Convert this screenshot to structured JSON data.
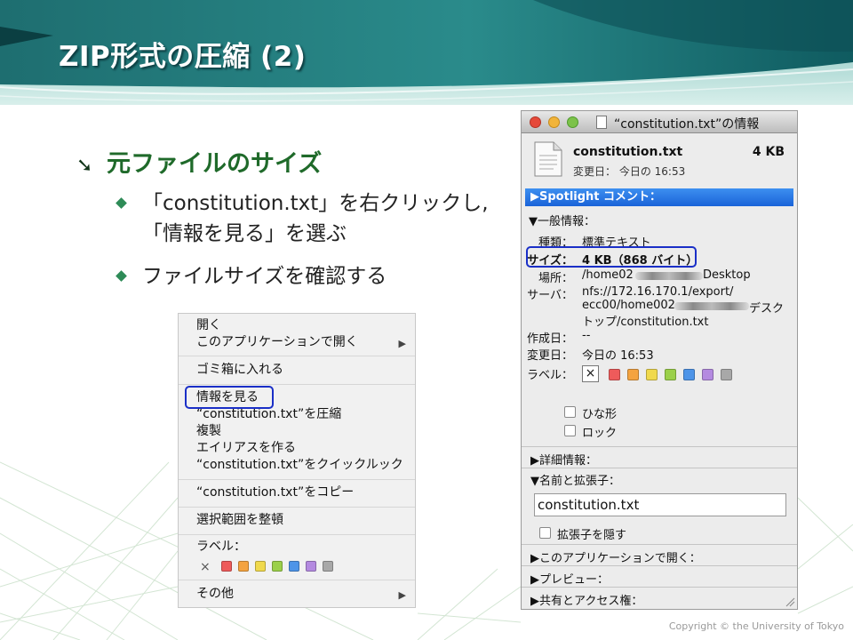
{
  "slide": {
    "title": "ZIP形式の圧縮 (2)",
    "bullet_main": "元ファイルのサイズ",
    "sub_bullets": [
      "「constitution.txt」を右クリックし,",
      "「情報を見る」を選ぶ",
      "ファイルサイズを確認する"
    ],
    "copyright": "Copyright © the University of Tokyo",
    "colors": {
      "header_teal": "#1e6e70",
      "bullet_green": "#1f6a2a",
      "highlight_blue": "#1a2fc7"
    }
  },
  "context_menu": {
    "items": [
      "開く",
      "このアプリケーションで開く",
      "ゴミ箱に入れる",
      "情報を見る",
      "“constitution.txt”を圧縮",
      "複製",
      "エイリアスを作る",
      "“constitution.txt”をクイックルック",
      "“constitution.txt”をコピー",
      "選択範囲を整頓",
      "ラベル：",
      "その他"
    ],
    "label_x": "×",
    "label_colors": [
      "#ee5b5b",
      "#f4a340",
      "#f0d94c",
      "#9bd04a",
      "#4d94e8",
      "#b48ae0",
      "#a8a8a8"
    ],
    "submenu_icon": "triangle-right-icon"
  },
  "info_window": {
    "title": "“constitution.txt”の情報",
    "file_name": "constitution.txt",
    "file_size": "4 KB",
    "modified_short": "変更日：  今日の 16:53",
    "spotlight": "Spotlight コメント：",
    "general_header": "一般情報：",
    "kind_label": "種類：",
    "kind_value": "標準テキスト",
    "size_label": "サイズ：",
    "size_value": "4 KB（868 バイト）",
    "where_label": "場所：",
    "where_value_pre": "/home02",
    "where_value_post": "Desktop",
    "server_label": "サーバ：",
    "server_line1": "nfs://172.16.170.1/export/",
    "server_line2_pre": "ecc00/home002",
    "server_line2_post": "デスク",
    "server_line3": "トップ/constitution.txt",
    "created_label": "作成日：",
    "created_value": "--",
    "modified_label": "変更日：",
    "modified_value": "今日の 16:53",
    "label_label": "ラベル：",
    "label_x": "×",
    "label_colors": [
      "#ee5b5b",
      "#f4a340",
      "#f0d94c",
      "#9bd04a",
      "#4d94e8",
      "#b48ae0",
      "#a8a8a8"
    ],
    "stationery": "ひな形",
    "locked": "ロック",
    "more_info": "詳細情報：",
    "name_ext": "名前と拡張子：",
    "name_field_value": "constitution.txt",
    "hide_ext": "拡張子を隠す",
    "open_with": "このアプリケーションで開く：",
    "preview": "プレビュー：",
    "sharing": "共有とアクセス権："
  }
}
